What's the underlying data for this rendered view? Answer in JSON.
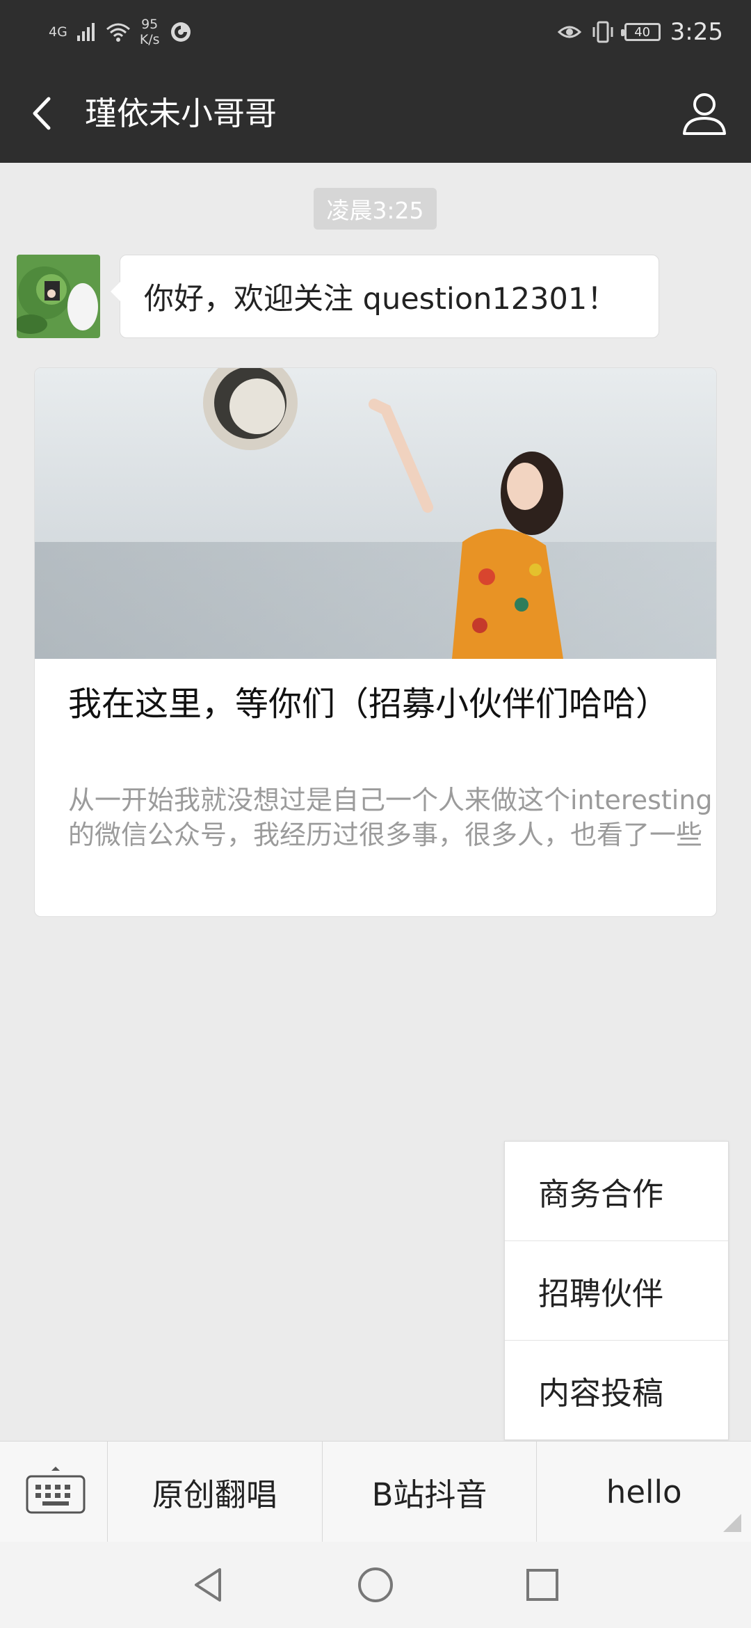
{
  "status_bar": {
    "network": "4G",
    "speed_value": "95",
    "speed_unit": "K/s",
    "battery": "40",
    "time": "3:25"
  },
  "header": {
    "title": "瑾依未小哥哥"
  },
  "chat": {
    "timestamp": "凌晨3:25",
    "message": "你好，欢迎关注 question12301！"
  },
  "article": {
    "title": "我在这里，等你们（招募小伙伴们哈哈）",
    "summary": "从一开始我就没想过是自己一个人来做这个interesting的微信公众号，我经历过很多事，很多人，也看了一些"
  },
  "submenu": {
    "items": [
      {
        "label": "商务合作"
      },
      {
        "label": "招聘伙伴"
      },
      {
        "label": "内容投稿"
      }
    ]
  },
  "menu_bar": {
    "tabs": [
      {
        "label": "原创翻唱"
      },
      {
        "label": "B站抖音"
      },
      {
        "label": "hello"
      }
    ]
  },
  "colors": {
    "header_bg": "#2e2e2e",
    "chat_bg": "#ebebeb",
    "bubble_bg": "#ffffff"
  },
  "icons": [
    "wifi-icon",
    "signal-icon",
    "sync-icon",
    "eye-icon",
    "vibrate-icon",
    "battery-icon",
    "back-arrow-icon",
    "profile-icon",
    "keyboard-icon",
    "nav-back-icon",
    "nav-home-icon",
    "nav-recents-icon"
  ]
}
